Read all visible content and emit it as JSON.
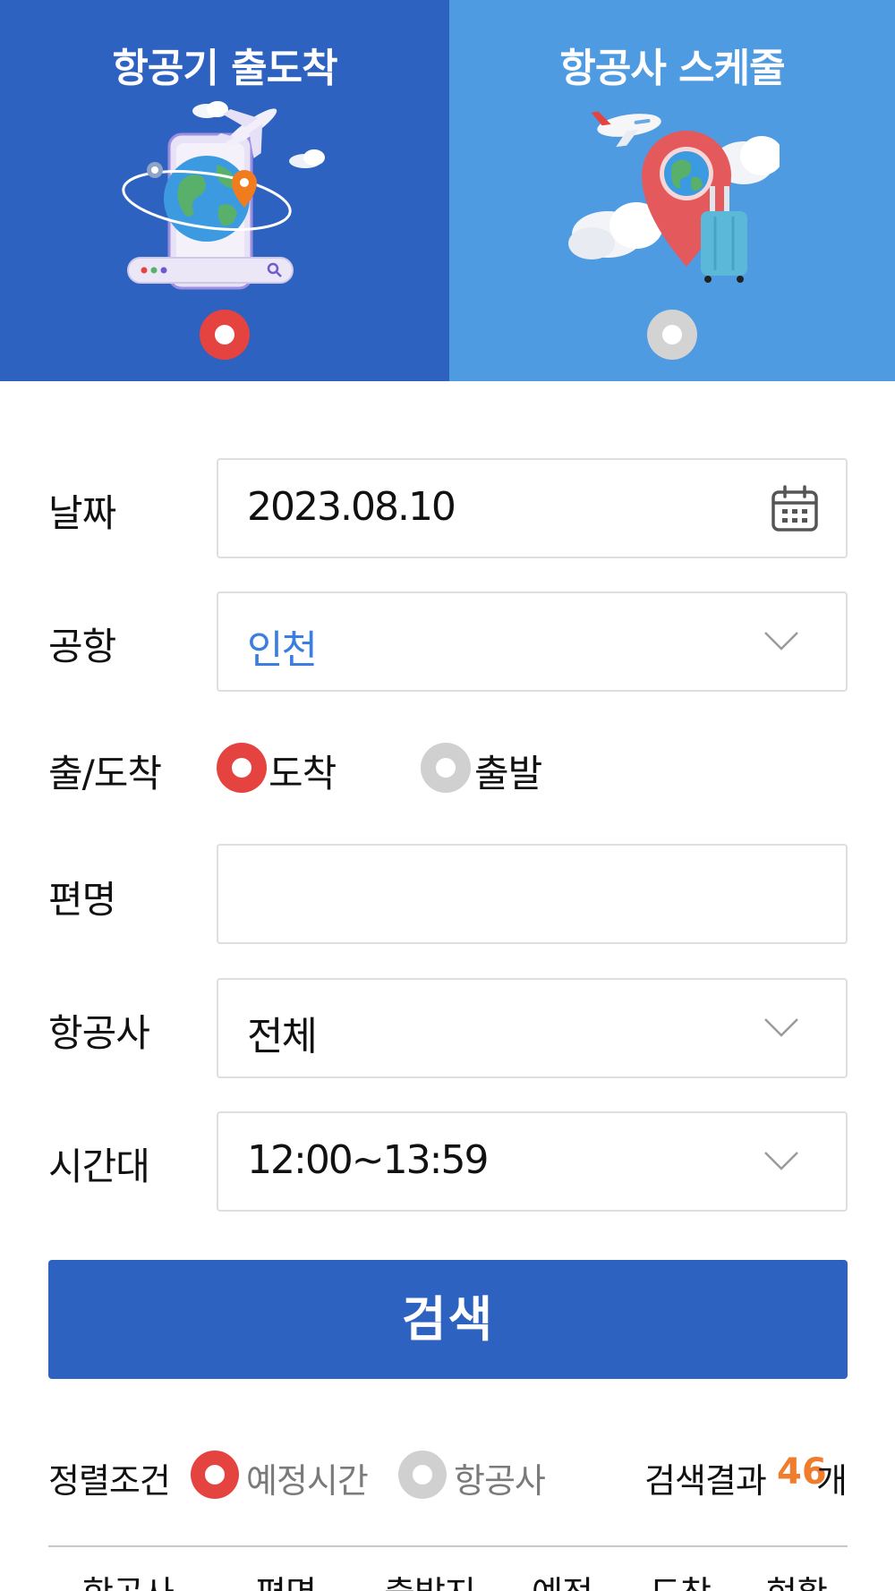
{
  "tabs": [
    {
      "title": "항공기 출도착",
      "active": true,
      "icon": "globe-phone-airplane-illustration"
    },
    {
      "title": "항공사 스케줄",
      "active": false,
      "icon": "location-pin-suitcase-illustration"
    }
  ],
  "form": {
    "date": {
      "label": "날짜",
      "value": "2023.08.10",
      "icon": "calendar-icon"
    },
    "airport": {
      "label": "공항",
      "value": "인천",
      "icon": "chevron-down-icon"
    },
    "direction": {
      "label": "출/도착",
      "options": [
        {
          "label": "도착",
          "selected": true
        },
        {
          "label": "출발",
          "selected": false
        }
      ]
    },
    "flight": {
      "label": "편명",
      "value": "",
      "placeholder": ""
    },
    "airline": {
      "label": "항공사",
      "value": "전체",
      "icon": "chevron-down-icon"
    },
    "time": {
      "label": "시간대",
      "value": "12:00~13:59",
      "icon": "chevron-down-icon"
    }
  },
  "search_button": "검색",
  "sort": {
    "label": "정렬조건",
    "options": [
      {
        "label": "예정시간",
        "selected": true
      },
      {
        "label": "항공사",
        "selected": false
      }
    ]
  },
  "results": {
    "label": "검색결과",
    "count": "46",
    "unit": "개"
  },
  "table_headers": [
    "항공사",
    "편명",
    "출발지",
    "예정",
    "도착",
    "현황"
  ],
  "colors": {
    "primary": "#2e62c0",
    "secondary": "#4e9be2",
    "selected": "#e5433f",
    "unselected": "#d0d0d0",
    "accent_text": "#3a7ee0",
    "count": "#f07c2e"
  }
}
